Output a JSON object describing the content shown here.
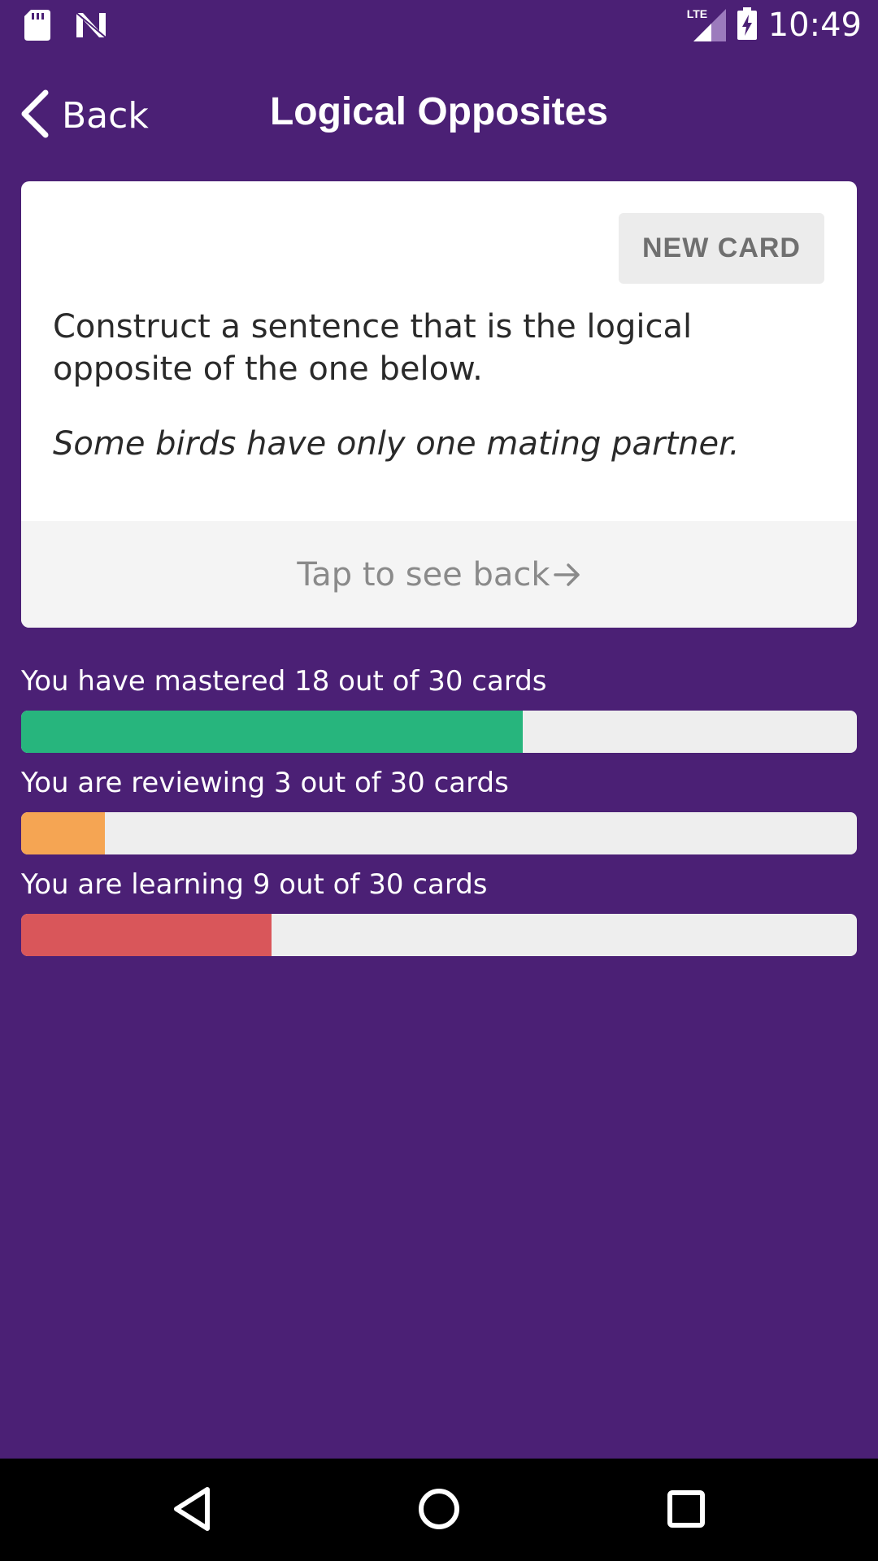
{
  "status_bar": {
    "time": "10:49",
    "network_label": "LTE",
    "icons": [
      "sd-card-icon",
      "n-notification-icon",
      "lte-signal-icon",
      "battery-charging-icon"
    ]
  },
  "header": {
    "back_label": "Back",
    "title": "Logical Opposites"
  },
  "card": {
    "new_card_label": "NEW CARD",
    "instructions": "Construct a sentence that is the logical opposite of the one below.",
    "sentence": "Some birds have only one mating partner.",
    "footer_label": "Tap to see back"
  },
  "progress": [
    {
      "label": "You have mastered 18 out of 30 cards",
      "count": 18,
      "total": 30,
      "color": "#27b57d"
    },
    {
      "label": "You are reviewing 3 out of 30 cards",
      "count": 3,
      "total": 30,
      "color": "#f5a553"
    },
    {
      "label": "You are learning 9 out of 30 cards",
      "count": 9,
      "total": 30,
      "color": "#d9565a"
    }
  ],
  "colors": {
    "background": "#4b2075",
    "card": "#ffffff",
    "track": "#eeeeee"
  }
}
